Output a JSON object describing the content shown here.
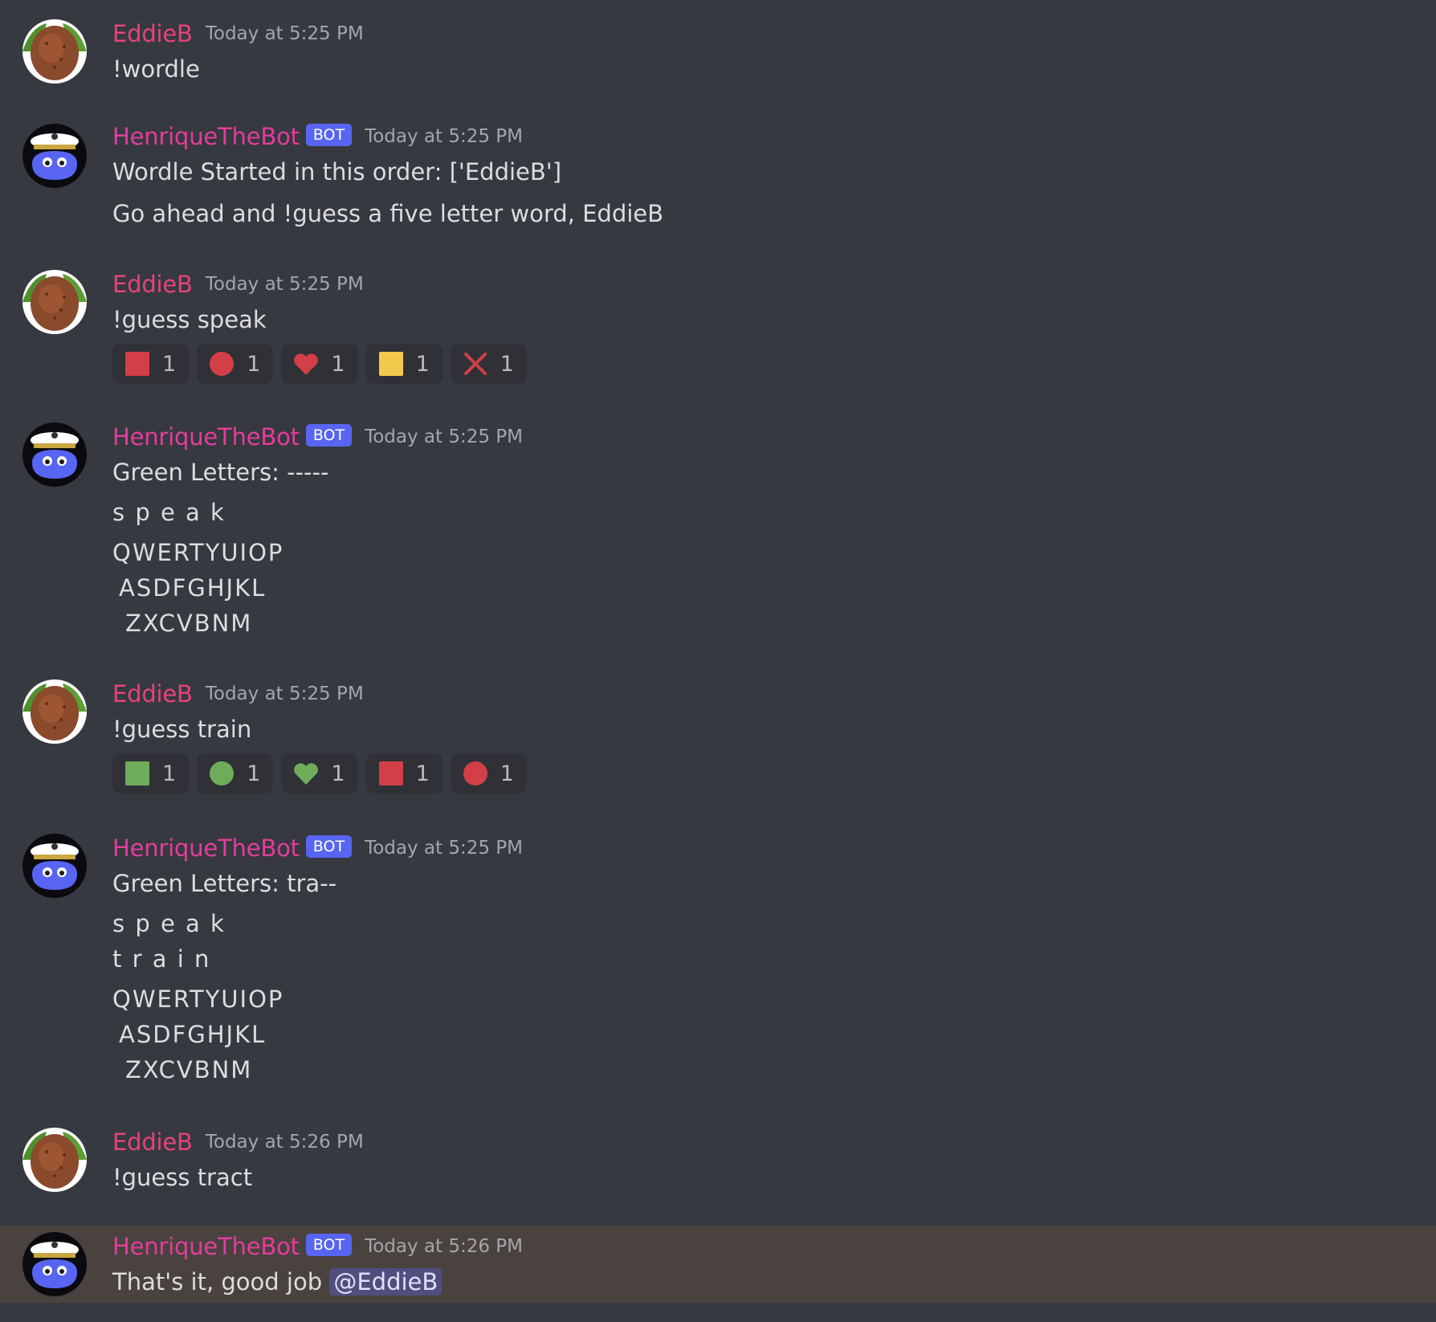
{
  "colors": {
    "background": "#36393f",
    "user_name": "#e6437a",
    "bot_name": "#e33d9c",
    "bot_tag": "#5865f2",
    "red": "#d23f47",
    "green": "#6fac5a",
    "yellow": "#f2c94c",
    "highlight": "#4a423f"
  },
  "messages": [
    {
      "author": "EddieB",
      "bot": false,
      "timestamp": "Today at 5:25 PM",
      "lines": [
        "!wordle"
      ]
    },
    {
      "author": "HenriqueTheBot",
      "bot": true,
      "bot_tag": "BOT",
      "timestamp": "Today at 5:25 PM",
      "lines": [
        "Wordle Started in this order: ['EddieB']",
        "Go ahead and !guess a five letter word, EddieB"
      ]
    },
    {
      "author": "EddieB",
      "bot": false,
      "timestamp": "Today at 5:25 PM",
      "lines": [
        "!guess speak"
      ],
      "reactions": [
        {
          "icon": "red-square-icon",
          "count": "1"
        },
        {
          "icon": "red-circle-icon",
          "count": "1"
        },
        {
          "icon": "red-heart-icon",
          "count": "1"
        },
        {
          "icon": "yellow-square-icon",
          "count": "1"
        },
        {
          "icon": "red-x-icon",
          "count": "1"
        }
      ]
    },
    {
      "author": "HenriqueTheBot",
      "bot": true,
      "bot_tag": "BOT",
      "timestamp": "Today at 5:25 PM",
      "lines": [
        "Green Letters: -----"
      ],
      "board": [
        "s p e a k"
      ],
      "keyboard": [
        "QWERTYUIOP",
        "ASDFGHJKL",
        "ZXCVBNM"
      ]
    },
    {
      "author": "EddieB",
      "bot": false,
      "timestamp": "Today at 5:25 PM",
      "lines": [
        "!guess train"
      ],
      "reactions": [
        {
          "icon": "green-square-icon",
          "count": "1"
        },
        {
          "icon": "green-circle-icon",
          "count": "1"
        },
        {
          "icon": "green-heart-icon",
          "count": "1"
        },
        {
          "icon": "red-square-icon",
          "count": "1"
        },
        {
          "icon": "red-circle-icon",
          "count": "1"
        }
      ]
    },
    {
      "author": "HenriqueTheBot",
      "bot": true,
      "bot_tag": "BOT",
      "timestamp": "Today at 5:25 PM",
      "lines": [
        "Green Letters: tra--"
      ],
      "board": [
        "s p e a k",
        "t r a i n"
      ],
      "keyboard": [
        "QWERTYUIOP",
        "ASDFGHJKL",
        "ZXCVBNM"
      ]
    },
    {
      "author": "EddieB",
      "bot": false,
      "timestamp": "Today at 5:26 PM",
      "lines": [
        "!guess tract"
      ]
    },
    {
      "author": "HenriqueTheBot",
      "bot": true,
      "bot_tag": "BOT",
      "timestamp": "Today at 5:26 PM",
      "lines": [
        "That's it, good job "
      ],
      "mention": "@EddieB",
      "highlighted": true
    }
  ]
}
